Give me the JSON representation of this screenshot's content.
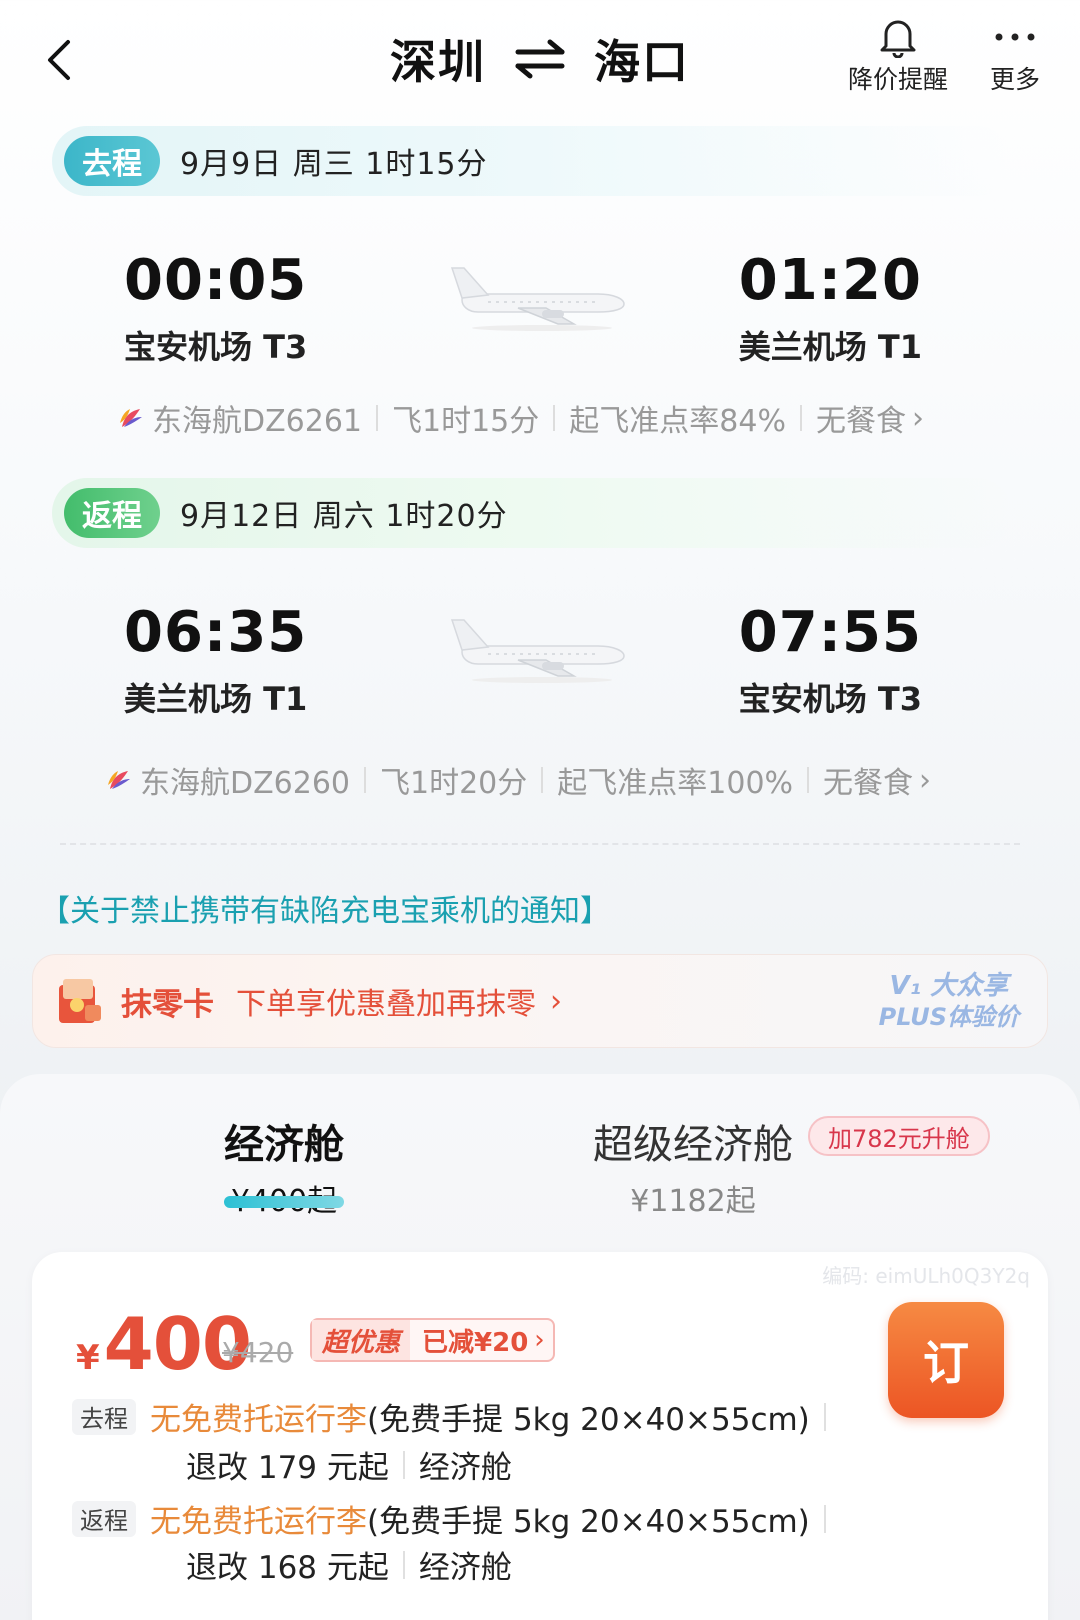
{
  "header": {
    "origin": "深圳",
    "destination": "海口",
    "price_alert_label": "降价提醒",
    "more_label": "更多"
  },
  "outbound": {
    "tag": "去程",
    "date_info": "9月9日 周三  1时15分",
    "depart_time": "00:05",
    "depart_airport": "宝安机场 T3",
    "arrive_time": "01:20",
    "arrive_airport": "美兰机场 T1",
    "airline_flight": "东海航DZ6261",
    "duration": "飞1时15分",
    "on_time": "起飞准点率84%",
    "meal": "无餐食"
  },
  "inbound": {
    "tag": "返程",
    "date_info": "9月12日 周六  1时20分",
    "depart_time": "06:35",
    "depart_airport": "美兰机场 T1",
    "arrive_time": "07:55",
    "arrive_airport": "宝安机场 T3",
    "airline_flight": "东海航DZ6260",
    "duration": "飞1时20分",
    "on_time": "起飞准点率100%",
    "meal": "无餐食"
  },
  "notice": "【关于禁止携带有缺陷充电宝乘机的通知】",
  "promo": {
    "title": "抹零卡",
    "subtitle": "下单享优惠叠加再抹零",
    "badge_line1": "V₁ 大众享",
    "badge_line2": "PLUS体验价"
  },
  "cabins": {
    "economy": {
      "name": "经济舱",
      "price": "¥400起"
    },
    "premium": {
      "name": "超级经济舱",
      "price": "¥1182起",
      "upgrade": "加782元升舱"
    }
  },
  "fare": {
    "code": "编码: eimULh0Q3Y2q",
    "currency": "¥",
    "price": "400",
    "original_price": "¥420",
    "tag_label": "超优惠",
    "tag_discount": "已减¥20",
    "book_label": "订",
    "legs": [
      {
        "tag": "去程",
        "baggage": "无免费托运行李",
        "carry_on": "(免费手提 5kg 20×40×55cm)",
        "change": "退改 179 元起",
        "cabin": "经济舱"
      },
      {
        "tag": "返程",
        "baggage": "无免费托运行李",
        "carry_on": "(免费手提 5kg 20×40×55cm)",
        "change": "退改 168 元起",
        "cabin": "经济舱"
      }
    ]
  },
  "colors": {
    "accent_orange": "#e4503a",
    "teal": "#3cb6c9",
    "green": "#43bd6c",
    "book_button": "#ec5524"
  }
}
